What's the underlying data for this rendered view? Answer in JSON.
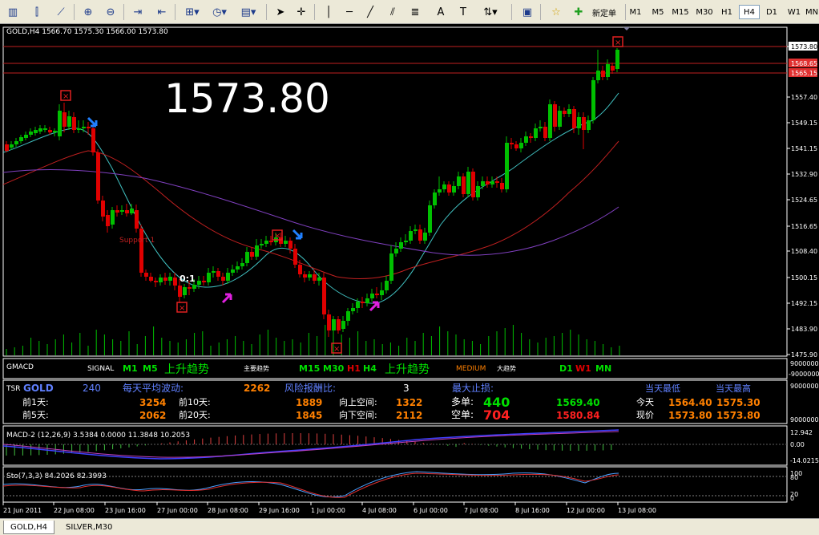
{
  "toolbar": {
    "new_order_label": "新定单",
    "timeframes": [
      "M1",
      "M5",
      "M15",
      "M30",
      "H1",
      "H4",
      "D1",
      "W1",
      "MN"
    ],
    "active_timeframe": "H4"
  },
  "main_chart": {
    "header": "GOLD,H4  1566.70 1575.30 1566.00 1573.80",
    "big_price": "1573.80",
    "support_label": "Support 1",
    "marker_label": "0:1",
    "price_axis": [
      "1573.80",
      "1557.40",
      "1549.15",
      "1541.15",
      "1532.90",
      "1524.65",
      "1516.65",
      "1508.40",
      "1500.15",
      "1492.15",
      "1483.90",
      "1475.90"
    ],
    "line_tags": [
      {
        "label": "1568.65",
        "color": "#e03030"
      },
      {
        "label": "1565.15",
        "color": "#e03030"
      }
    ]
  },
  "gmacd": {
    "name": "GMACD",
    "signal_label": "SIGNAL",
    "tf_left": [
      "M1",
      "M5"
    ],
    "trend_left": "上升趋势",
    "main_trend_label": "主要趋势",
    "tf_mid": [
      "M15",
      "M30",
      "H1",
      "H4"
    ],
    "trend_mid": "上升趋势",
    "medium_label": "MEDIUM",
    "big_trend_label": "大趋势",
    "tf_right": [
      "D1",
      "W1",
      "MN"
    ],
    "axis": [
      "9000000",
      "-9000000"
    ]
  },
  "tsr": {
    "name": "TSR",
    "symbol": "GOLD",
    "value": "240",
    "daily_vol_label": "每天平均波动:",
    "daily_vol": "2262",
    "risk_label": "风险报酬比:",
    "risk": "3",
    "max_sl_label": "最大止损:",
    "prev1_label": "前1天:",
    "prev1": "3254",
    "prev10_label": "前10天:",
    "prev10": "1889",
    "up_space_label": "向上空间:",
    "up_space": "1322",
    "prev5_label": "前5天:",
    "prev5": "2062",
    "prev20_label": "前20天:",
    "prev20": "1845",
    "down_space_label": "向下空间:",
    "down_space": "2112",
    "long_label": "多单:",
    "long_val": "440",
    "long_price": "1569.40",
    "short_label": "空单:",
    "short_val": "704",
    "short_price": "1580.84",
    "today_low_label": "当天最低",
    "today_high_label": "当天最高",
    "today_label": "今天",
    "today_low": "1564.40",
    "today_high": "1575.30",
    "current_label": "现价",
    "current_a": "1573.80",
    "current_b": "1573.80",
    "axis": [
      "9000000",
      "9000000"
    ]
  },
  "macd": {
    "header": "MACD-2 (12,26,9) 3.5384 0.0000 11.3848 10.2053",
    "axis": [
      "12.942",
      "0.00",
      "-14.0215"
    ]
  },
  "stoch": {
    "header": "Sto(7,3,3) 84.2026 82.3993",
    "axis": [
      "100",
      "80",
      "20",
      "0"
    ]
  },
  "time_axis": [
    "21 Jun 2011",
    "22 Jun 08:00",
    "23 Jun 16:00",
    "27 Jun 00:00",
    "28 Jun 08:00",
    "29 Jun 16:00",
    "1 Jul 00:00",
    "4 Jul 08:00",
    "6 Jul 00:00",
    "7 Jul 08:00",
    "8 Jul 16:00",
    "12 Jul 00:00",
    "13 Jul 08:00"
  ],
  "bottom_tabs": [
    "GOLD,H4",
    "SILVER,M30"
  ],
  "colors": {
    "bull": "#00c000",
    "bear": "#e00000",
    "ma_fast": "#40c0c0",
    "ma_mid": "#c02020",
    "ma_slow": "#8040c0",
    "arrow_blue": "#2080ff",
    "arrow_magenta": "#e020e0"
  }
}
